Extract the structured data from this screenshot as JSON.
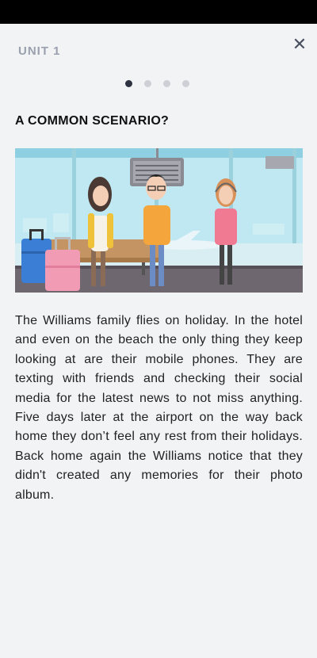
{
  "header": {
    "unit_label": "UNIT 1",
    "close_icon": "close-icon"
  },
  "pager": {
    "total_pages": 4,
    "current_page": 1
  },
  "content": {
    "title": "A COMMON SCENARIO?",
    "illustration": "airport-waiting-family-illustration",
    "story": "The Williams family flies on holiday. In the hotel and even on the beach the only thing they keep looking at are their mobile phones. They are texting with friends and checking their social media for the latest news to not miss anything. Five days later at the airport on the way back home they don’t feel any rest from their holidays. Back home again the Williams notice that they didn't created any memories for their photo album."
  },
  "colors": {
    "background": "#f2f3f5",
    "active_dot": "#2d3240",
    "inactive_dot": "#cdd0d6"
  }
}
